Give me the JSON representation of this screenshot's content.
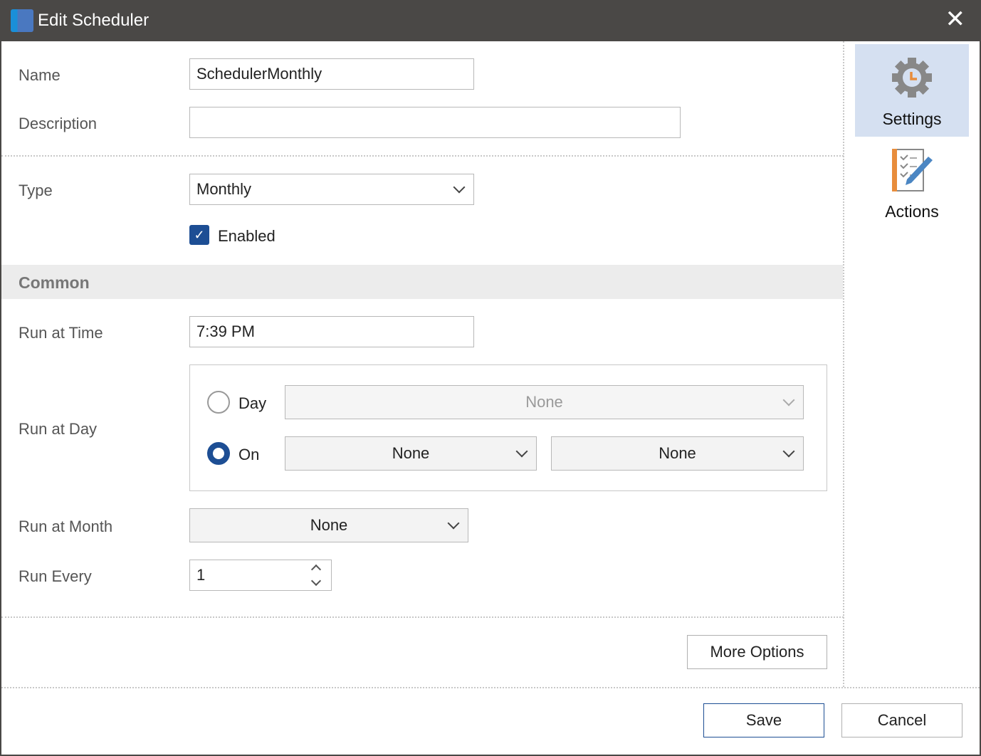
{
  "window": {
    "title": "Edit Scheduler",
    "close_icon": "close-icon"
  },
  "form": {
    "name": {
      "label": "Name",
      "value": "SchedulerMonthly"
    },
    "description": {
      "label": "Description",
      "value": ""
    },
    "type": {
      "label": "Type",
      "value": "Monthly"
    },
    "enabled": {
      "label": "Enabled",
      "checked": true
    },
    "section_common": "Common",
    "run_at_time": {
      "label": "Run at Time",
      "value": "7:39 PM"
    },
    "run_at_day": {
      "label": "Run at Day",
      "day_label": "Day",
      "day_value": "None",
      "on_label": "On",
      "on_value1": "None",
      "on_value2": "None",
      "selected": "On"
    },
    "run_at_month": {
      "label": "Run at Month",
      "value": "None"
    },
    "run_every": {
      "label": "Run Every",
      "value": "1"
    },
    "more_options": "More Options"
  },
  "sidebar": {
    "items": [
      {
        "label": "Settings",
        "icon": "gear-clock-icon",
        "active": true
      },
      {
        "label": "Actions",
        "icon": "checklist-pencil-icon",
        "active": false
      }
    ]
  },
  "footer": {
    "save": "Save",
    "cancel": "Cancel"
  },
  "colors": {
    "titlebar": "#4a4846",
    "accent": "#1d4e94",
    "sidebar_active": "#d5e0f1",
    "icon_orange": "#e88d3c"
  }
}
